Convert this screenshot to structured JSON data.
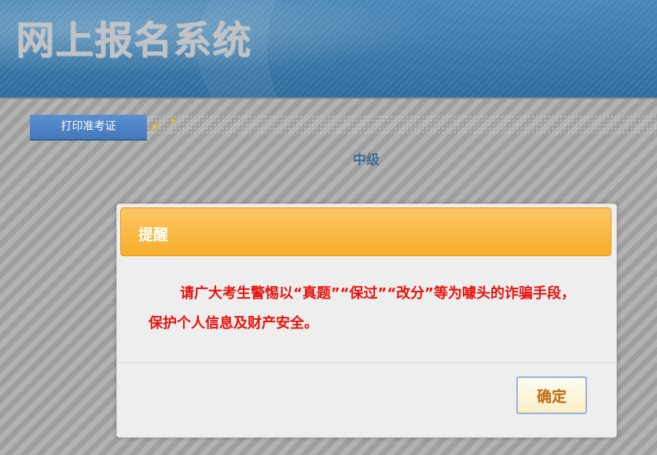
{
  "header": {
    "site_title": "网上报名系统"
  },
  "nav": {
    "print_tab_label": "打印准考证",
    "star_glyph": "★"
  },
  "content": {
    "level_label": "中级"
  },
  "modal": {
    "title": "提醒",
    "message": "请广大考生警惕以“真题”“保过”“改分”等为噱头的诈骗手段，保护个人信息及财产安全。",
    "confirm_label": "确定"
  },
  "colors": {
    "header_blue": "#3b79a8",
    "tab_blue": "#4f85c8",
    "modal_header_orange": "#f7ad2c",
    "warning_red": "#e8130c",
    "button_text_orange": "#c06a10"
  }
}
